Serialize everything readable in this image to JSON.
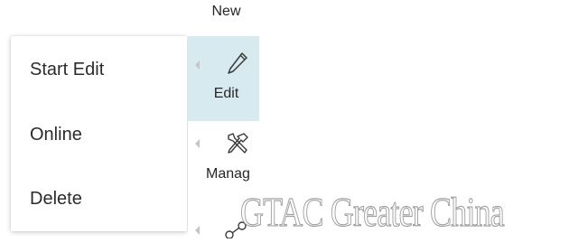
{
  "context_menu": {
    "items": [
      {
        "label": "Start Edit"
      },
      {
        "label": "Online"
      },
      {
        "label": "Delete"
      }
    ]
  },
  "ribbon": {
    "buttons": [
      {
        "label": "New",
        "icon": "new-icon"
      },
      {
        "label": "Edit",
        "icon": "pencil-icon",
        "selected": true
      },
      {
        "label": "Manag",
        "icon": "tools-icon"
      },
      {
        "label": "",
        "icon": "share-icon"
      }
    ],
    "selected_color": "#d6eaf0"
  },
  "watermark": {
    "text": "GTAC Greater China"
  }
}
